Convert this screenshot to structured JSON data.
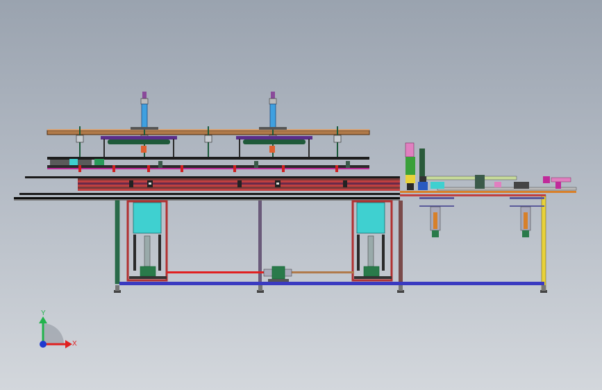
{
  "viewport": {
    "background_top": "#9aa3af",
    "background_bottom": "#d3d7dc"
  },
  "triad": {
    "y_label": "Y",
    "x_label": "X",
    "y_color": "#22b34c",
    "x_color": "#e02020",
    "z_color": "#1f3ad0"
  },
  "colors": {
    "frame_dark": "#2b2b2b",
    "frame_red": "#c0392b",
    "frame_purple": "#5a2d8a",
    "frame_olive": "#7a7a3a",
    "wood": "#b07a4a",
    "cylinder_blue": "#3fa0e0",
    "guard_cyan": "#3fd0d0",
    "motor_green": "#2a7a4a",
    "bar_orange": "#d8802a",
    "bar_yellow": "#e8d23a",
    "magenta": "#c02a9a",
    "base_blue": "#3a3ac0"
  }
}
